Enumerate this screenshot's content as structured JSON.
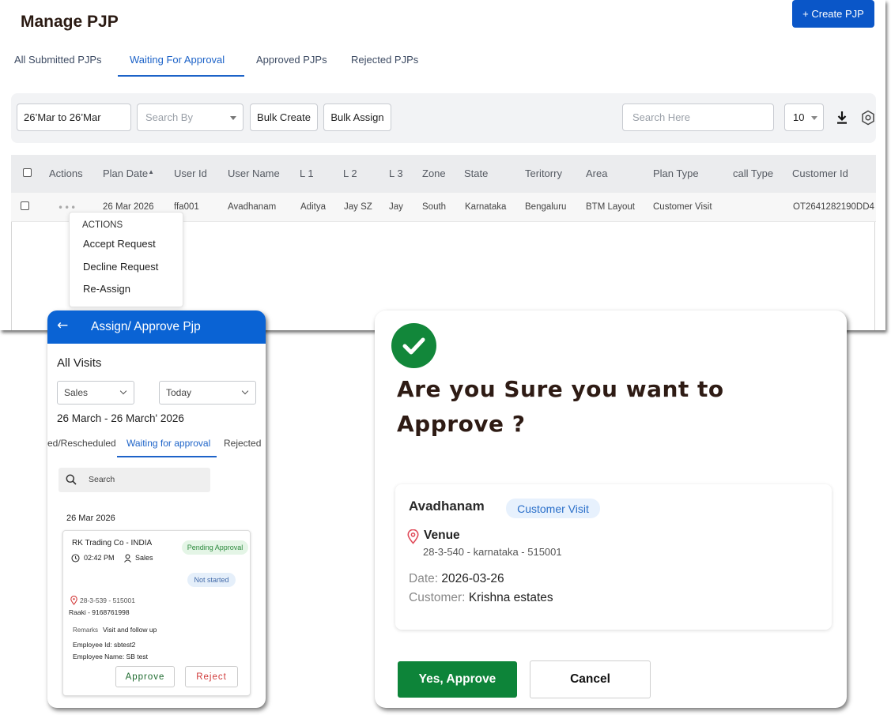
{
  "web": {
    "title": "Manage PJP",
    "create_button": "+ Create PJP",
    "tabs": [
      "All Submitted PJPs",
      "Waiting For Approval",
      "Approved PJPs",
      "Rejected PJPs"
    ],
    "active_tab": "Waiting For Approval",
    "toolbar": {
      "date_range": "26’Mar to 26’Mar",
      "search_by_placeholder": "Search By",
      "bulk_create": "Bulk Create",
      "bulk_assign": "Bulk Assign",
      "search_placeholder": "Search Here",
      "page_size": "10"
    },
    "columns": [
      "Actions",
      "Plan Date",
      "User Id",
      "User Name",
      "L 1",
      "L 2",
      "L 3",
      "Zone",
      "State",
      "Teritorry",
      "Area",
      "Plan Type",
      "call Type",
      "Customer Id"
    ],
    "row": {
      "actions": "•••",
      "plan_date": "26 Mar 2026",
      "user_id": "ffa001",
      "user_name": "Avadhanam",
      "l1": "Aditya",
      "l2": "Jay SZ",
      "l3": "Jay",
      "zone": "South",
      "state": "Karnataka",
      "territory": "Bengaluru",
      "area": "BTM Layout",
      "plan_type": "Customer Visit",
      "call_type": "",
      "customer_id": "OT2641282190DD4"
    },
    "actions_menu": {
      "header": "ACTIONS",
      "items": [
        "Accept Request",
        "Decline Request",
        "Re-Assign"
      ]
    }
  },
  "mobile": {
    "title": "Assign/ Approve Pjp",
    "section": "All Visits",
    "filter_role": "Sales",
    "filter_period": "Today",
    "date_range": "26 March - 26 March' 2026",
    "tabs": [
      "ed/Rescheduled",
      "Waiting for approval",
      "Rejected"
    ],
    "active_tab": "Waiting for approval",
    "search_placeholder": "Search",
    "group_date": "26 Mar 2026",
    "card": {
      "customer": "RK Trading Co - INDIA",
      "status": "Pending Approval",
      "time": "02:42 PM",
      "role": "Sales",
      "visit_status": "Not started",
      "address": "28-3-539 - 515001",
      "contact": "Raaki - 9168761998",
      "remarks_label": "Remarks",
      "remarks": "Visit and follow up",
      "employee_id": "Employee Id: sbtest2",
      "employee_name": "Employee Name: SB test",
      "approve": "Approve",
      "reject": "Reject"
    }
  },
  "dialog": {
    "title": "Are you Sure you want to Approve ?",
    "name": "Avadhanam",
    "plan_type": "Customer Visit",
    "venue_label": "Venue",
    "address": "28-3-540 - karnataka - 515001",
    "date_label": "Date:",
    "date": "2026-03-26",
    "customer_label": "Customer:",
    "customer": "Krishna estates",
    "approve_button": "Yes, Approve",
    "cancel_button": "Cancel"
  },
  "colors": {
    "primary_blue": "#0a56c8",
    "approve_green": "#0d8439",
    "title_brown": "#2e1b14"
  }
}
